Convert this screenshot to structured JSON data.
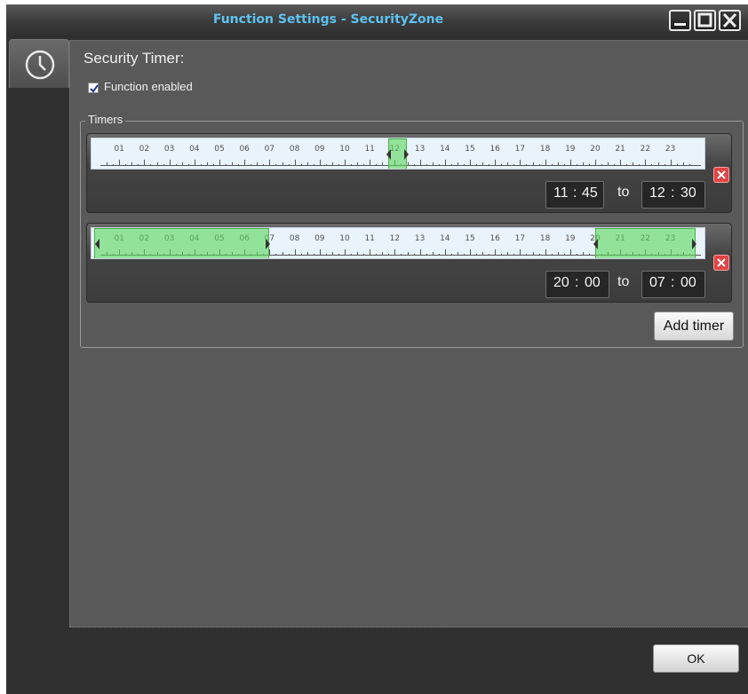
{
  "window": {
    "title": "Function Settings - SecurityZone",
    "title_color": "#5fc3f0",
    "controls": [
      "minimize-icon",
      "maximize-icon",
      "close-icon"
    ]
  },
  "sidebar": {
    "tabs": [
      {
        "icon": "clock-icon",
        "selected": true
      }
    ]
  },
  "function": {
    "heading": "Security Timer:",
    "enabled_label": "Function enabled",
    "enabled": true
  },
  "timers": {
    "group_label": "Timers",
    "tick_labels": [
      "01",
      "02",
      "03",
      "04",
      "05",
      "06",
      "07",
      "08",
      "09",
      "10",
      "11",
      "12",
      "13",
      "14",
      "15",
      "16",
      "17",
      "18",
      "19",
      "20",
      "21",
      "22",
      "23"
    ],
    "selection_color": "#5ad75a",
    "delete_color": "#e04545",
    "items": [
      {
        "from_h": "11",
        "from_m": "45",
        "sep": ":",
        "to_label": "to",
        "to_h": "12",
        "to_m": "30",
        "start": 11.75,
        "end": 12.5
      },
      {
        "from_h": "20",
        "from_m": "00",
        "sep": ":",
        "to_label": "to",
        "to_h": "07",
        "to_m": "00",
        "start": 20.0,
        "end": 7.0
      }
    ],
    "add_label": "Add timer"
  },
  "footer": {
    "ok_label": "OK"
  }
}
